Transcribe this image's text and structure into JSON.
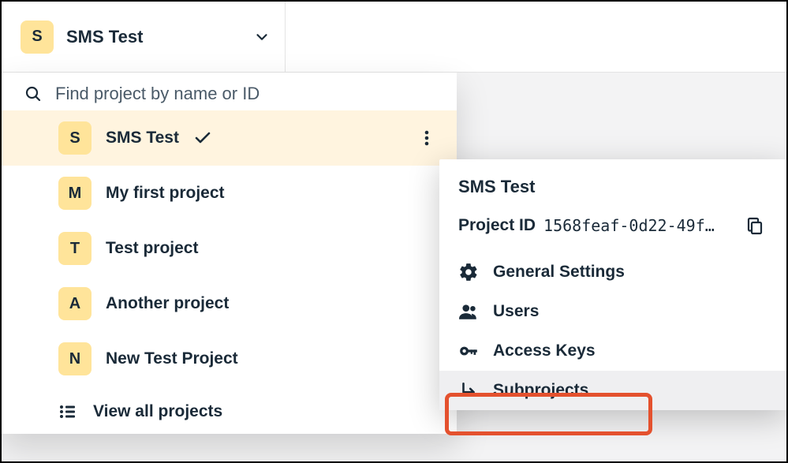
{
  "picker": {
    "avatar_letter": "S",
    "label": "SMS Test"
  },
  "search": {
    "placeholder": "Find project by name or ID"
  },
  "projects": [
    {
      "letter": "S",
      "name": "SMS Test",
      "selected": true
    },
    {
      "letter": "M",
      "name": "My first project",
      "selected": false
    },
    {
      "letter": "T",
      "name": "Test project",
      "selected": false
    },
    {
      "letter": "A",
      "name": "Another project",
      "selected": false
    },
    {
      "letter": "N",
      "name": "New Test Project",
      "selected": false
    }
  ],
  "view_all_label": "View all projects",
  "context": {
    "title": "SMS Test",
    "id_label": "Project ID",
    "id_value": "1568feaf-0d22-49f…",
    "items": {
      "settings": "General Settings",
      "users": "Users",
      "access_keys": "Access Keys",
      "subprojects": "Subprojects"
    }
  }
}
